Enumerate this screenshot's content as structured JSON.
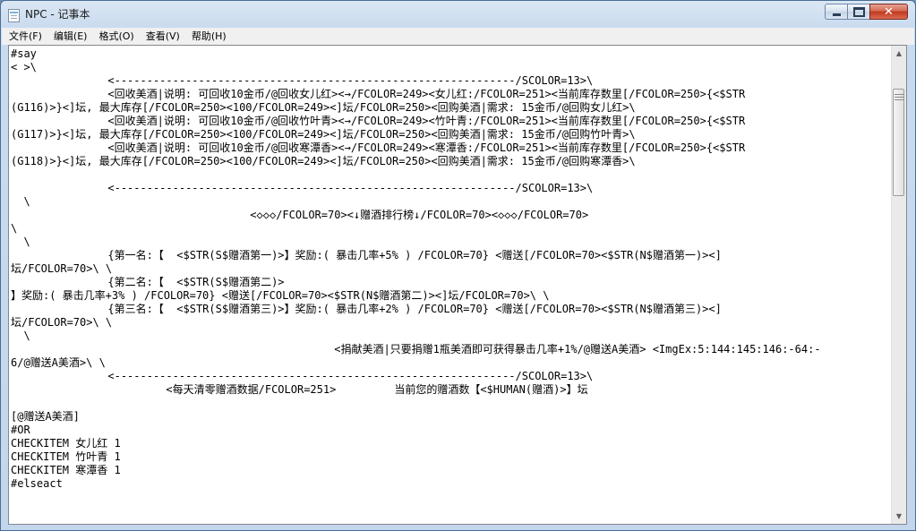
{
  "window": {
    "title": "NPC - 记事本"
  },
  "menu": [
    {
      "label": "文件(F)"
    },
    {
      "label": "编辑(E)"
    },
    {
      "label": "格式(O)"
    },
    {
      "label": "查看(V)"
    },
    {
      "label": "帮助(H)"
    }
  ],
  "editor": {
    "lines": [
      "#say",
      "< >\\",
      "               <--------------------------------------------------------------/SCOLOR=13>\\",
      "               <回收美酒|说明: 可回收10金币/@回收女儿红><→/FCOLOR=249><女儿红:/FCOLOR=251><当前库存数里[/FCOLOR=250>{<$STR",
      "(G116)>}<]坛, 最大库存[/FCOLOR=250><100/FCOLOR=249><]坛/FCOLOR=250><回购美酒|需求: 15金币/@回购女儿红>\\",
      "               <回收美酒|说明: 可回收10金币/@回收竹叶青><→/FCOLOR=249><竹叶青:/FCOLOR=251><当前库存数里[/FCOLOR=250>{<$STR",
      "(G117)>}<]坛, 最大库存[/FCOLOR=250><100/FCOLOR=249><]坛/FCOLOR=250><回购美酒|需求: 15金币/@回购竹叶青>\\",
      "               <回收美酒|说明: 可回收10金币/@回收寒潭香><→/FCOLOR=249><寒潭香:/FCOLOR=251><当前库存数里[/FCOLOR=250>{<$STR",
      "(G118)>}<]坛, 最大库存[/FCOLOR=250><100/FCOLOR=249><]坛/FCOLOR=250><回购美酒|需求: 15金币/@回购寒潭香>\\",
      "",
      "               <--------------------------------------------------------------/SCOLOR=13>\\",
      "  \\",
      "                                     <◇◇◇/FCOLOR=70><↓赠酒排行榜↓/FCOLOR=70><◇◇◇/FCOLOR=70>",
      "\\",
      "  \\",
      "               {第一名:【  <$STR(S$赠酒第一)>】奖励:( 暴击几率+5% ) /FCOLOR=70} <赠送[/FCOLOR=70><$STR(N$赠酒第一)><]",
      "坛/FCOLOR=70>\\ \\",
      "               {第二名:【  <$STR(S$赠酒第二)>",
      "】奖励:( 暴击几率+3% ) /FCOLOR=70} <赠送[/FCOLOR=70><$STR(N$赠酒第二)><]坛/FCOLOR=70>\\ \\",
      "               {第三名:【  <$STR(S$赠酒第三)>】奖励:( 暴击几率+2% ) /FCOLOR=70} <赠送[/FCOLOR=70><$STR(N$赠酒第三)><]",
      "坛/FCOLOR=70>\\ \\",
      "  \\",
      "                                                  <捐献美酒|只要捐赠1瓶美酒即可获得暴击几率+1%/@赠送A美酒> <ImgEx:5:144:145:146:-64:-",
      "6/@赠送A美酒>\\ \\",
      "               <--------------------------------------------------------------/SCOLOR=13>\\",
      "                        <每天清零赠酒数据/FCOLOR=251>         当前您的赠酒数【<$HUMAN(赠酒)>】坛",
      "",
      "[@赠送A美酒]",
      "#OR",
      "CHECKITEM 女儿红 1",
      "CHECKITEM 竹叶青 1",
      "CHECKITEM 寒潭香 1",
      "#elseact"
    ]
  }
}
